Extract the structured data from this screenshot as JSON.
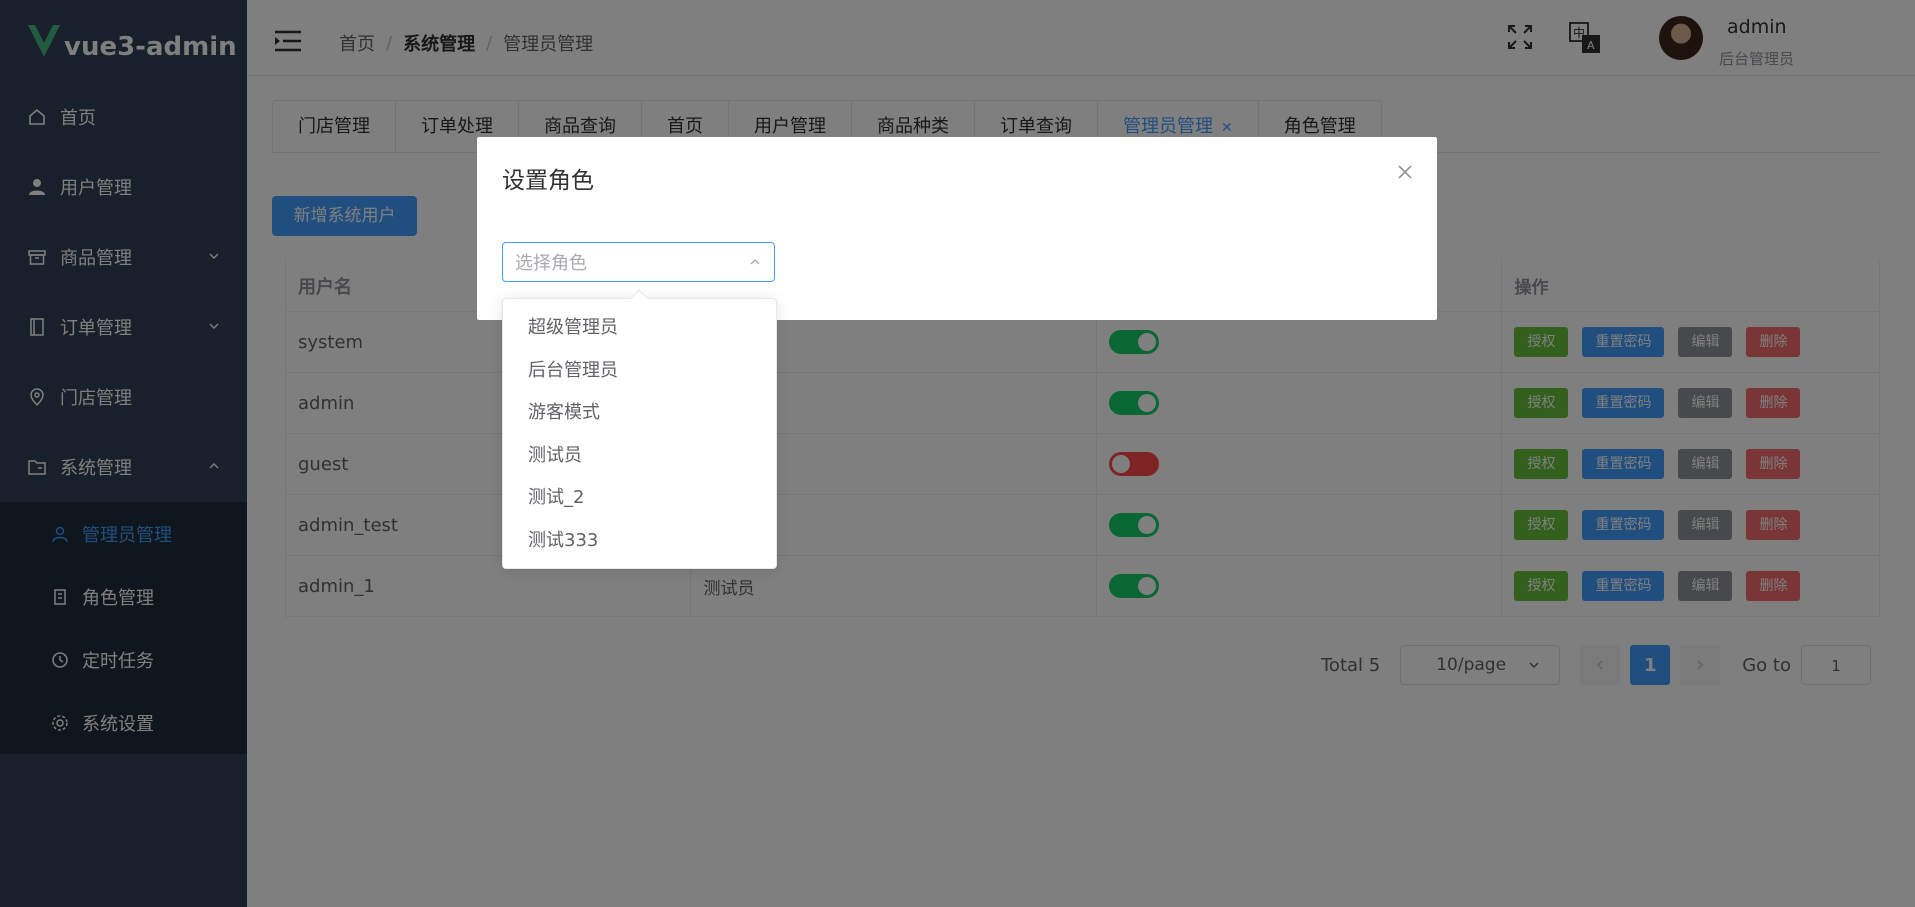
{
  "app": {
    "title": "vue3-admin"
  },
  "sidebar": {
    "items": [
      {
        "label": "首页",
        "icon": "home-icon"
      },
      {
        "label": "用户管理",
        "icon": "user-icon"
      },
      {
        "label": "商品管理",
        "icon": "box-icon"
      },
      {
        "label": "订单管理",
        "icon": "order-icon"
      },
      {
        "label": "门店管理",
        "icon": "location-icon"
      },
      {
        "label": "系统管理",
        "icon": "folder-icon"
      }
    ],
    "sub_items": [
      {
        "label": "管理员管理",
        "icon": "user-icon"
      },
      {
        "label": "角色管理",
        "icon": "document-icon"
      },
      {
        "label": "定时任务",
        "icon": "clock-icon"
      },
      {
        "label": "系统设置",
        "icon": "gear-icon"
      }
    ]
  },
  "header": {
    "breadcrumb": [
      "首页",
      "系统管理",
      "管理员管理"
    ],
    "user_name": "admin",
    "user_role": "后台管理员"
  },
  "tabs": [
    "门店管理",
    "订单处理",
    "商品查询",
    "首页",
    "用户管理",
    "商品种类",
    "订单查询",
    "管理员管理",
    "角色管理"
  ],
  "toolbar": {
    "add_label": "新增系统用户"
  },
  "table": {
    "headers": [
      "用户名",
      "",
      "",
      "操作"
    ],
    "rows": [
      {
        "username": "system",
        "role": "员",
        "enabled": true
      },
      {
        "username": "admin",
        "role": "员",
        "enabled": true
      },
      {
        "username": "guest",
        "role": "",
        "enabled": false
      },
      {
        "username": "admin_test",
        "role": "",
        "enabled": true
      },
      {
        "username": "admin_1",
        "role": "测试员",
        "enabled": true
      }
    ],
    "actions": {
      "grant": "授权",
      "reset": "重置密码",
      "edit": "编辑",
      "delete": "删除"
    }
  },
  "pagination": {
    "total": "Total 5",
    "page_size": "10/page",
    "current_page": "1",
    "goto_label": "Go to",
    "goto_value": "1"
  },
  "dialog": {
    "title": "设置角色",
    "select_placeholder": "选择角色",
    "options": [
      "超级管理员",
      "后台管理员",
      "游客模式",
      "测试员",
      "测试_2",
      "测试333"
    ]
  },
  "colors": {
    "sidebar_bg": "#304156",
    "primary": "#409eff",
    "success": "#67c23a",
    "danger": "#f56c6c",
    "switch_on": "#13ce66",
    "switch_off": "#ff4949"
  }
}
